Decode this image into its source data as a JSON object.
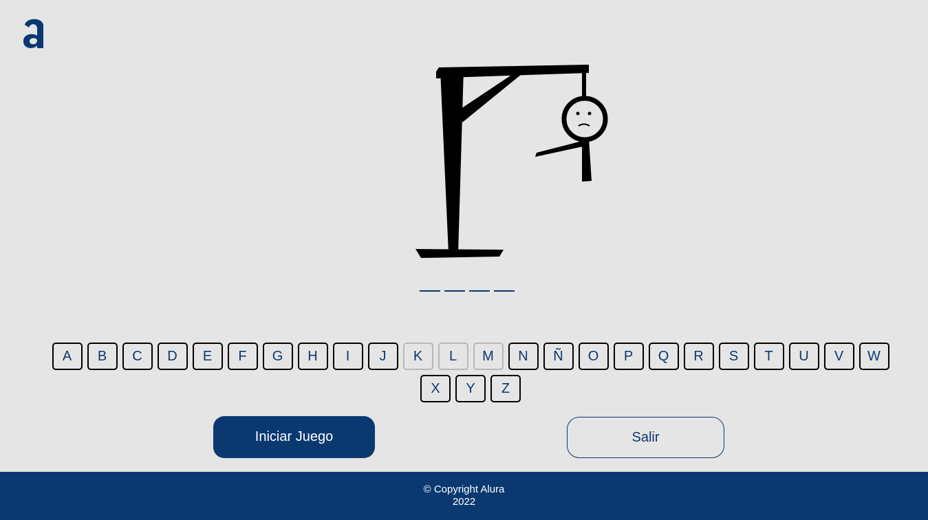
{
  "logo": {
    "icon": "alura-logo-icon",
    "color": "#0a3871"
  },
  "word": {
    "slots": 4
  },
  "keyboard": {
    "rows": [
      [
        "A",
        "B",
        "C",
        "D",
        "E",
        "F",
        "G",
        "H",
        "I",
        "J",
        "K",
        "L",
        "M",
        "N",
        "Ñ",
        "O",
        "P",
        "Q",
        "R",
        "S",
        "T",
        "U",
        "V",
        "W"
      ],
      [
        "X",
        "Y",
        "Z"
      ]
    ],
    "disabled": [
      "K",
      "L",
      "M"
    ]
  },
  "buttons": {
    "start_label": "Iniciar Juego",
    "exit_label": "Salir"
  },
  "footer": {
    "line1": "© Copyright Alura",
    "line2": "2022"
  },
  "colors": {
    "primary": "#0a3871",
    "background": "#e5e5e5"
  }
}
